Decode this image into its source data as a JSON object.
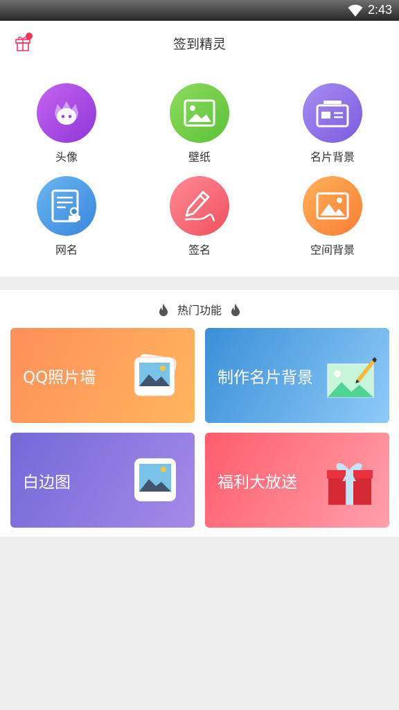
{
  "status_bar": {
    "time": "2:43"
  },
  "header": {
    "title": "签到精灵"
  },
  "grid": {
    "items": [
      {
        "label": "头像",
        "icon": "avatar-icon",
        "color_from": "#c564f0",
        "color_to": "#8e36d8"
      },
      {
        "label": "壁纸",
        "icon": "wallpaper-icon",
        "color_from": "#8ddc5c",
        "color_to": "#5cc13a"
      },
      {
        "label": "名片背景",
        "icon": "card-icon",
        "color_from": "#a98cf0",
        "color_to": "#7a5ce0"
      },
      {
        "label": "网名",
        "icon": "nickname-icon",
        "color_from": "#6ab6f2",
        "color_to": "#3a86dc"
      },
      {
        "label": "签名",
        "icon": "signature-icon",
        "color_from": "#ff8a96",
        "color_to": "#f0505e"
      },
      {
        "label": "空间背景",
        "icon": "space-background-icon",
        "color_from": "#ffb05a",
        "color_to": "#fb7e34"
      }
    ]
  },
  "hot": {
    "title": "热门功能",
    "cards": [
      {
        "label": "QQ照片墙",
        "icon": "photo-stack-icon",
        "color_from": "#ff8f5a",
        "color_to": "#ffb55e"
      },
      {
        "label": "制作名片背景",
        "icon": "edit-image-icon",
        "color_from": "#3a8fd8",
        "color_to": "#8fcaf8"
      },
      {
        "label": "白边图",
        "icon": "framed-image-icon",
        "color_from": "#7468d8",
        "color_to": "#a58ae8"
      },
      {
        "label": "福利大放送",
        "icon": "gift-box-icon",
        "color_from": "#ff5c6c",
        "color_to": "#ffa0aa"
      }
    ]
  }
}
